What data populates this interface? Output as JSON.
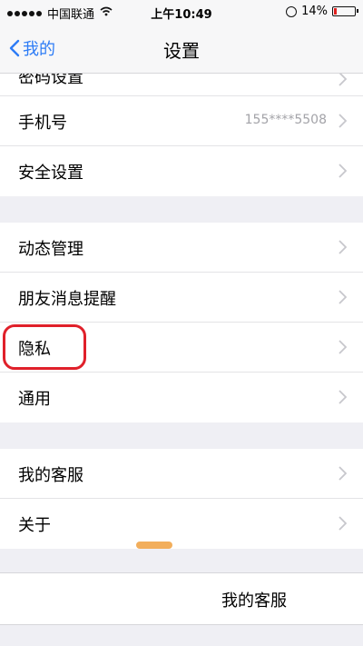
{
  "status_bar": {
    "carrier": "中国联通",
    "time": "上午10:49",
    "battery": "14%",
    "battery_level": 0.14
  },
  "nav": {
    "back_label": "我的",
    "title": "设置"
  },
  "group1": [
    {
      "label": "密码设置"
    },
    {
      "label": "手机号",
      "value": "155****5508"
    },
    {
      "label": "安全设置"
    }
  ],
  "group2": [
    {
      "label": "动态管理"
    },
    {
      "label": "朋友消息提醒"
    },
    {
      "label": "隐私"
    },
    {
      "label": "通用"
    }
  ],
  "group3": [
    {
      "label": "我的客服"
    },
    {
      "label": "关于"
    }
  ],
  "bottom_sheet": {
    "label": "我的客服"
  }
}
